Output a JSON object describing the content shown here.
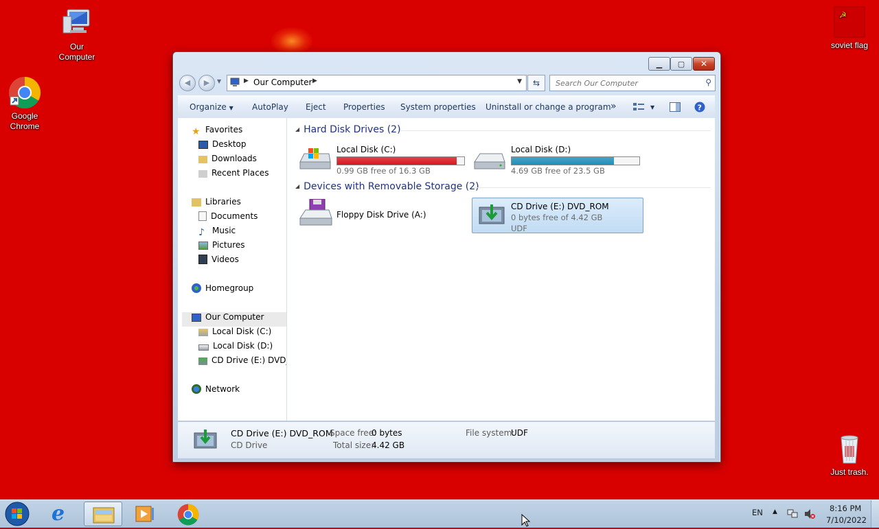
{
  "desktop": {
    "icons": [
      {
        "label": "Our\nComputer"
      },
      {
        "label": "Google\nChrome"
      },
      {
        "label": "soviet flag"
      },
      {
        "label": "Just trash."
      }
    ]
  },
  "window": {
    "address": {
      "path": "Our Computer"
    },
    "search": {
      "placeholder": "Search Our Computer"
    },
    "toolbar": {
      "organize": "Organize",
      "autoplay": "AutoPlay",
      "eject": "Eject",
      "properties": "Properties",
      "system_properties": "System properties",
      "uninstall": "Uninstall or change a program",
      "more": "»"
    },
    "nav": {
      "favorites": "Favorites",
      "desktop": "Desktop",
      "downloads": "Downloads",
      "recent": "Recent Places",
      "libraries": "Libraries",
      "documents": "Documents",
      "music": "Music",
      "pictures": "Pictures",
      "videos": "Videos",
      "homegroup": "Homegroup",
      "computer": "Our Computer",
      "disk_c": "Local Disk (C:)",
      "disk_d": "Local Disk (D:)",
      "cd": "CD Drive (E:) DVD_ROM",
      "network": "Network"
    },
    "groups": {
      "hdd": "Hard Disk Drives (2)",
      "removable": "Devices with Removable Storage (2)"
    },
    "drives": {
      "c": {
        "name": "Local Disk (C:)",
        "free": "0.99 GB free of 16.3 GB",
        "used_fraction": 0.94,
        "bar_color": "#d8171e"
      },
      "d": {
        "name": "Local Disk (D:)",
        "free": "4.69 GB free of 23.5 GB",
        "used_fraction": 0.8,
        "bar_color": "#1f8fb8"
      },
      "a": {
        "name": "Floppy Disk Drive (A:)"
      },
      "e": {
        "name": "CD Drive (E:) DVD_ROM",
        "free": "0 bytes free of 4.42 GB",
        "fs": "UDF"
      }
    },
    "details": {
      "name": "CD Drive (E:) DVD_ROM",
      "type": "CD Drive",
      "space_free_label": "Space free:",
      "space_free": "0 bytes",
      "total_size_label": "Total size:",
      "total_size": "4.42 GB",
      "fs_label": "File system:",
      "fs": "UDF"
    }
  },
  "taskbar": {
    "lang": "EN",
    "time": "8:16 PM",
    "date": "7/10/2022"
  },
  "colors": {
    "desktop": "#d90000",
    "accent": "#1e3287"
  }
}
